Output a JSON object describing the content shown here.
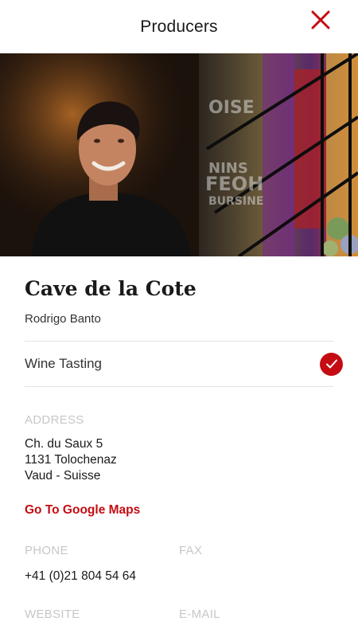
{
  "header": {
    "title": "Producers",
    "close_icon": "close-icon",
    "accent": "#c40c12"
  },
  "producer": {
    "name": "Cave de la Cote",
    "owner": "Rodrigo Banto"
  },
  "services": [
    {
      "label": "Wine Tasting",
      "checked": true,
      "icon": "check-icon"
    }
  ],
  "address": {
    "label": "ADDRESS",
    "lines": [
      "Ch. du Saux 5",
      "1131 Tolochenaz",
      "Vaud - Suisse"
    ],
    "maps_link": "Go To Google Maps"
  },
  "contact": {
    "phone_label": "PHONE",
    "phone_value": "+41 (0)21 804 54 64",
    "fax_label": "FAX",
    "website_label": "WEBSITE",
    "email_label": "E-MAIL"
  }
}
